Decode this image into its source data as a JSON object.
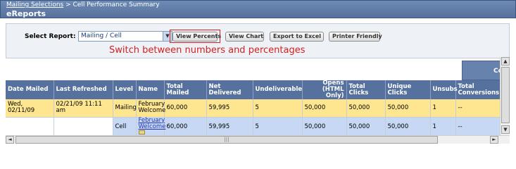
{
  "header": {
    "breadcrumb_link": "Mailing Selections",
    "breadcrumb_sep": " > ",
    "breadcrumb_current": "Cell Performance Summary",
    "title": "eReports"
  },
  "toolbar": {
    "select_label": "Select Report:",
    "select_value": "Mailing / Cell",
    "buttons": {
      "view_percents": "View Percents",
      "view_chart": "View Chart",
      "export_excel": "Export to Excel",
      "printer_friendly": "Printer Friendly"
    },
    "hint": "Switch between numbers and percentages"
  },
  "table": {
    "group_header": "Co",
    "columns": [
      "Date Mailed",
      "Last Refreshed",
      "Level",
      "Name",
      "Total Mailed",
      "Net Delivered",
      "Undeliverable",
      "Opens (HTML Only)",
      "Total Clicks",
      "Unique Clicks",
      "Unsubs",
      "Total Conversions"
    ],
    "rows": [
      {
        "date_mailed": "Wed, 02/11/09",
        "last_refreshed": "02/21/09 11:11 am",
        "level": "Mailing",
        "name": "February Welcome",
        "total_mailed": "60,000",
        "net_delivered": "59,995",
        "undeliverable": "5",
        "opens": "50,000",
        "total_clicks": "50,000",
        "unique_clicks": "50,000",
        "unsubs": "1",
        "conversions": "--"
      },
      {
        "date_mailed": "",
        "last_refreshed": "",
        "level": "Cell",
        "name": "February Welcome",
        "total_mailed": "60,000",
        "net_delivered": "59,995",
        "undeliverable": "5",
        "opens": "50,000",
        "total_clicks": "50,000",
        "unique_clicks": "50,000",
        "unsubs": "1",
        "conversions": "--"
      }
    ]
  },
  "scroll": {
    "up": "▲",
    "down": "▼",
    "left": "◄",
    "right": "►",
    "grip": "|||"
  }
}
